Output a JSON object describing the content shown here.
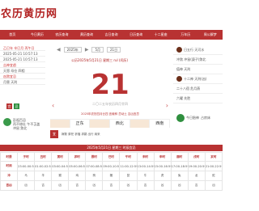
{
  "site": {
    "title": "农历黄历网"
  },
  "nav": [
    "首页",
    "今日黄历",
    "农历查询",
    "黄历查询",
    "吉日查询",
    "日历查询",
    "十二星座",
    "万年历",
    "周公解梦"
  ],
  "left": {
    "rows": [
      "乙巳年 辛巳月 丙午日",
      "2025-05-21 10:57:13",
      "2025-05-21 10:57:13",
      "吉神宜趋",
      "天恩 母仓 四相",
      "凶煞宜忌",
      "月害 天刑"
    ],
    "squares": [
      "宜",
      "忌"
    ],
    "note_lines": [
      "彭祖百忌",
      "丙不修灶 午不苫盖",
      "冲鼠 煞北"
    ]
  },
  "center": {
    "prev_arrow": "◀",
    "year_select": "2025年",
    "month_select": "5月",
    "day_select": "21日",
    "next_arrow": "▶",
    "solar_info": "公历2025年5月21日   星期三   rul (闰历)",
    "day_number": "21",
    "lunar_sub": "二〇二五年农历四月廿四",
    "stars": "2025年农历四月廿四  宜栽种  忌动土  吉凶宜忌",
    "directions": [
      "",
      "正东",
      "",
      "西北",
      "",
      "西南"
    ],
    "yi_label": "宜",
    "yi_text": "嫁娶 祭祀 祈福 求嗣 出行 纳采",
    "left_nav": "‹",
    "right_nav": "›"
  },
  "right": {
    "rows": [
      "日五行 天河水",
      "冲煞 冲鼠(庚子)煞北",
      "值神 天刑",
      "十二神 天刑(凶)",
      "二十八宿 危月燕",
      "六曜 先胜"
    ],
    "bottom": [
      "今日胎神",
      "占房床"
    ]
  },
  "hours": {
    "title": "2025年5月21日 星期三 时辰宜忌",
    "header": [
      "时辰",
      "子时",
      "丑时",
      "寅时",
      "卯时",
      "辰时",
      "巳时",
      "午时",
      "未时",
      "申时",
      "酉时",
      "戌时",
      "亥时"
    ],
    "rows": [
      [
        "时间",
        "23:00-00:59",
        "01:00-02:59",
        "03:00-04:59",
        "05:00-06:59",
        "07:00-08:59",
        "09:00-10:59",
        "11:00-12:59",
        "13:00-14:59",
        "15:00-16:59",
        "17:00-18:59",
        "19:00-20:59",
        "21:00-22:59"
      ],
      [
        "冲",
        "马",
        "羊",
        "猴",
        "鸡",
        "狗",
        "猪",
        "鼠",
        "牛",
        "虎",
        "兔",
        "龙",
        "蛇"
      ],
      [
        "吉凶",
        "凶",
        "吉",
        "凶",
        "吉",
        "凶",
        "吉",
        "凶",
        "吉",
        "凶",
        "凶",
        "吉",
        "凶"
      ]
    ]
  },
  "colors": {
    "primary": "#b83232",
    "green": "#2f8f3f",
    "accent_bg": "#f7e7d6"
  }
}
